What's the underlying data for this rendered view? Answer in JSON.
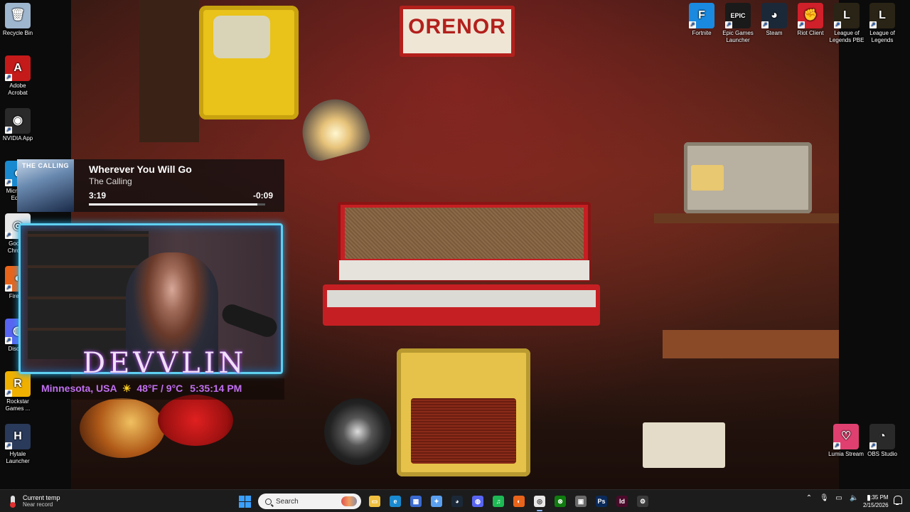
{
  "desktop": {
    "left_icons": [
      {
        "label": "Recycle Bin",
        "icon": "recycle-bin-icon",
        "color": "#9fb6cf",
        "glyph": "🗑"
      },
      {
        "label": "Adobe Acrobat",
        "icon": "acrobat-icon",
        "color": "#c51a1a",
        "glyph": "A"
      },
      {
        "label": "NVIDIA App",
        "icon": "nvidia-icon",
        "color": "#2a2a2a",
        "glyph": "◉"
      },
      {
        "label": "Microsoft Edge",
        "icon": "edge-icon",
        "color": "#1a8ad0",
        "glyph": "e"
      },
      {
        "label": "Google Chrome",
        "icon": "chrome-icon",
        "color": "#e8e8e8",
        "glyph": "◎"
      },
      {
        "label": "Firefox",
        "icon": "firefox-icon",
        "color": "#e8641a",
        "glyph": "◐"
      },
      {
        "label": "Discord",
        "icon": "discord-icon",
        "color": "#5865f2",
        "glyph": "◍"
      },
      {
        "label": "Rockstar Games ...",
        "icon": "rockstar-icon",
        "color": "#f0b000",
        "glyph": "R"
      },
      {
        "label": "Hytale Launcher",
        "icon": "hytale-icon",
        "color": "#2a3a5a",
        "glyph": "H"
      }
    ],
    "top_right_icons": [
      {
        "label": "Fortnite",
        "icon": "fortnite-icon",
        "color": "#1a8ae0",
        "glyph": "F"
      },
      {
        "label": "Epic Games Launcher",
        "icon": "epic-games-icon",
        "color": "#1a1a1a",
        "glyph": "EPIC"
      },
      {
        "label": "Steam",
        "icon": "steam-icon",
        "color": "#1b2838",
        "glyph": "◕"
      },
      {
        "label": "Riot Client",
        "icon": "riot-client-icon",
        "color": "#d0202a",
        "glyph": "✊"
      },
      {
        "label": "League of Legends PBE",
        "icon": "league-pbe-icon",
        "color": "#2a2416",
        "glyph": "L"
      },
      {
        "label": "League of Legends",
        "icon": "league-icon",
        "color": "#2a2416",
        "glyph": "L"
      }
    ],
    "bottom_right_icons": [
      {
        "label": "Lumia Stream",
        "icon": "lumia-stream-icon",
        "color": "#e04070",
        "glyph": "♡"
      },
      {
        "label": "OBS Studio",
        "icon": "obs-studio-icon",
        "color": "#2a2a2a",
        "glyph": "◔"
      }
    ],
    "wall_sign": "ORENOR"
  },
  "media": {
    "album_art_text": "THE CALLING",
    "title": "Wherever You Will Go",
    "artist": "The Calling",
    "elapsed": "3:19",
    "remaining": "-0:09",
    "progress": 0.957
  },
  "overlay": {
    "brand": "DEVVLIN",
    "location": "Minnesota, USA",
    "weather": "48°F / 9°C",
    "time": "5:35:14 PM"
  },
  "taskbar": {
    "weather_title": "Current temp",
    "weather_subtitle": "Near record",
    "search_placeholder": "Search",
    "apps": [
      {
        "name": "file-explorer-icon",
        "bg": "#f0c040",
        "glyph": "▭"
      },
      {
        "name": "edge-icon",
        "bg": "#1a8ad0",
        "glyph": "e"
      },
      {
        "name": "store-icon",
        "bg": "#3a6ad0",
        "glyph": "▦"
      },
      {
        "name": "copilot-icon",
        "bg": "#5aa0f0",
        "glyph": "✦"
      },
      {
        "name": "steam-icon",
        "bg": "#1b2838",
        "glyph": "◕"
      },
      {
        "name": "discord-icon",
        "bg": "#5865f2",
        "glyph": "◍"
      },
      {
        "name": "spotify-icon",
        "bg": "#1db954",
        "glyph": "♫"
      },
      {
        "name": "firefox-icon",
        "bg": "#e8641a",
        "glyph": "◐"
      },
      {
        "name": "chrome-icon",
        "bg": "#e8e8e8",
        "glyph": "◎"
      },
      {
        "name": "xbox-icon",
        "bg": "#107c10",
        "glyph": "⊗"
      },
      {
        "name": "app-icon",
        "bg": "#6a6a6a",
        "glyph": "▣"
      },
      {
        "name": "photoshop-icon",
        "bg": "#0a2a5a",
        "glyph": "Ps"
      },
      {
        "name": "indesign-icon",
        "bg": "#4a0a2a",
        "glyph": "Id"
      },
      {
        "name": "settings-icon",
        "bg": "#3a3a3a",
        "glyph": "⚙"
      }
    ],
    "clock_time": "5:35 PM",
    "clock_date": "2/15/2026"
  }
}
